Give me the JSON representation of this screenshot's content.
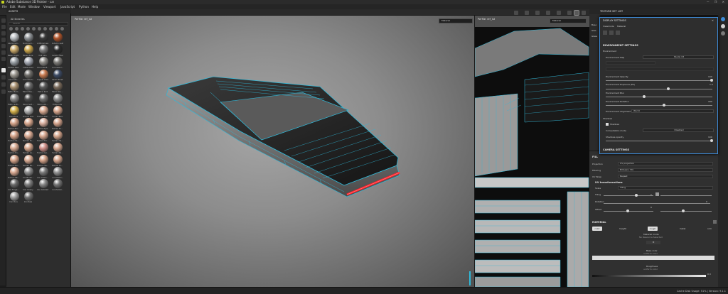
{
  "app": {
    "title": "Adobe Substance 3D Painter - car",
    "window_buttons": "— ❐ ✕"
  },
  "menu": [
    "File",
    "Edit",
    "Mode",
    "Window",
    "Viewport",
    "JavaScript",
    "Python",
    "Help"
  ],
  "assets": {
    "title": "ASSETS",
    "library": "All libraries",
    "search_placeholder": "Search",
    "materials": [
      {
        "name": "Aluminium...",
        "color": "#b8bcc0"
      },
      {
        "name": "Aluminum...",
        "color": "#8a8e92"
      },
      {
        "name": "Artificial Lea...",
        "color": "#3a3a3a"
      },
      {
        "name": "Autumn Leaf",
        "color": "#b0542a"
      },
      {
        "name": "Baked Light...",
        "color": "#c8a86a"
      },
      {
        "name": "Brass Pure",
        "color": "#c9a44a"
      },
      {
        "name": "Calf Skin",
        "color": "#7a7a7a"
      },
      {
        "name": "Carbon Fiber",
        "color": "#2a2a2a"
      },
      {
        "name": "Coated Met...",
        "color": "#9aa0a6"
      },
      {
        "name": "Cobalt Pure",
        "color": "#a6aab4"
      },
      {
        "name": "Concrete B...",
        "color": "#8c8a86"
      },
      {
        "name": "Concrete C...",
        "color": "#7c7a76"
      },
      {
        "name": "Concrete...",
        "color": "#9a968e"
      },
      {
        "name": "Concrete S...",
        "color": "#6e6c68"
      },
      {
        "name": "Copper Pure",
        "color": "#c87a50"
      },
      {
        "name": "Denim Rivet",
        "color": "#3c4a64"
      },
      {
        "name": "Fabric Bam...",
        "color": "#a89070"
      },
      {
        "name": "Fabric Bas...",
        "color": "#6a6a6a"
      },
      {
        "name": "Fabric Knit",
        "color": "#5a5a5a"
      },
      {
        "name": "Fabric Rou...",
        "color": "#7a6a5a"
      },
      {
        "name": "Fabric Soft...",
        "color": "#888888"
      },
      {
        "name": "Fabric Suit...",
        "color": "#4a4a4a"
      },
      {
        "name": "Fabric Wo...",
        "color": "#6c6c6c"
      },
      {
        "name": "Footprints",
        "color": "#8a8a8a"
      },
      {
        "name": "Gold Pure",
        "color": "#d4b04a"
      },
      {
        "name": "Ground Gra...",
        "color": "#b0b0b0"
      },
      {
        "name": "Human Bac...",
        "color": "#d8a890"
      },
      {
        "name": "Human Bell...",
        "color": "#d6a48a"
      },
      {
        "name": "Human Bu...",
        "color": "#d4a288"
      },
      {
        "name": "Human Ch...",
        "color": "#d8a68c"
      },
      {
        "name": "Human Eye...",
        "color": "#dab0a0"
      },
      {
        "name": "Human Fa...",
        "color": "#d6a48c"
      },
      {
        "name": "Human Fe...",
        "color": "#d4a086"
      },
      {
        "name": "Human Fo...",
        "color": "#d8a890"
      },
      {
        "name": "Human For...",
        "color": "#d6a68e"
      },
      {
        "name": "Human He...",
        "color": "#d4a48a"
      },
      {
        "name": "Human Kn...",
        "color": "#d8aa92"
      },
      {
        "name": "Human Le...",
        "color": "#d6a68c"
      },
      {
        "name": "Human Lip...",
        "color": "#d0908a"
      },
      {
        "name": "Human Ne...",
        "color": "#d8a890"
      },
      {
        "name": "Human No...",
        "color": "#d6a48a"
      },
      {
        "name": "Human Pa...",
        "color": "#d8aa92"
      },
      {
        "name": "Human Sh...",
        "color": "#d4a288"
      },
      {
        "name": "Human To...",
        "color": "#d6a68c"
      },
      {
        "name": "Human Wr...",
        "color": "#d8a890"
      },
      {
        "name": "Iron Brush...",
        "color": "#8c8c8c"
      },
      {
        "name": "Iron Chain...",
        "color": "#7a7a7a"
      },
      {
        "name": "Iron Diamo...",
        "color": "#909090"
      },
      {
        "name": "Iron Forge...",
        "color": "#6a6a6a"
      },
      {
        "name": "Iron Grainy",
        "color": "#7e7e7e"
      },
      {
        "name": "Iron Grinded",
        "color": "#888888"
      },
      {
        "name": "Iron Hamm...",
        "color": "#747474"
      },
      {
        "name": "Iron Pure",
        "color": "#a0a0a0"
      },
      {
        "name": "Iron Raw",
        "color": "#6e6e6e"
      }
    ]
  },
  "viewport3d": {
    "label": "Perfile: ref_lut",
    "dropdown": "Material"
  },
  "viewport2d": {
    "label": "Perfile: ref_lut",
    "dropdown": "Material"
  },
  "texture_set": {
    "title": "TEXTURE SET LIST",
    "items": [
      "Base",
      "Glas",
      "Glass"
    ]
  },
  "display": {
    "title": "DISPLAY SETTINGS",
    "view_label": "Viewmode",
    "view_value": "Material",
    "env_section": "ENVIRONMENT SETTINGS",
    "environment_sub": "Environment",
    "env_map_label": "Environment Map",
    "env_map_value": "Studio 03",
    "env_opacity_label": "Environment Opacity",
    "env_opacity_value": "100",
    "env_exposure_label": "Environment Exposure (EV)",
    "env_exposure_value": "1.0",
    "env_blur_label": "Environment Blur",
    "env_blur_value": "",
    "env_rotation_label": "Environment Rotation",
    "env_rotation_value": "180",
    "env_alignment_label": "Environment Alignment",
    "env_alignment_value": "World",
    "shadows_sub": "Shadows",
    "shadows_check": "Shadows",
    "comp_mode_label": "Computation mode",
    "comp_mode_value": "Disabled",
    "shadows_opacity_label": "Shadows opacity",
    "shadows_opacity_value": "100",
    "camera_section": "CAMERA SETTINGS"
  },
  "properties": {
    "title": "PROPERTIES",
    "fill_section": "FILL",
    "projection_label": "Projection",
    "projection_value": "UV projection",
    "filtering_label": "Filtering",
    "filtering_value": "Bilinear | HQ",
    "uv_wrap_label": "UV Wrap",
    "uv_wrap_value": "Repeat",
    "uv_section": "UV transformations",
    "scale_label": "Scale",
    "scale_value": "Tiling",
    "tiling_label": "Tiling",
    "tiling_value": "1",
    "rotation_label": "Rotation",
    "rotation_value": "0",
    "offset_label": "Offset",
    "offset_value": "0",
    "material_section": "MATERIAL",
    "channels": [
      "color",
      "height",
      "rough",
      "metal",
      "nrm"
    ],
    "material_mode_label": "Material mode",
    "material_mode_value": "No Resource Selected",
    "base_color_label": "Base color",
    "base_color_value": "uniform color",
    "roughness_label": "Roughness",
    "roughness_value": "uniform color",
    "roughness_num": "0.3"
  },
  "status": {
    "text": "Cache Disk Usage: 51% | Version: 9.1.1"
  },
  "colors": {
    "accent": "#3d8ad6",
    "wire": "#2fb8d8",
    "edge_red": "#ff1e28"
  }
}
